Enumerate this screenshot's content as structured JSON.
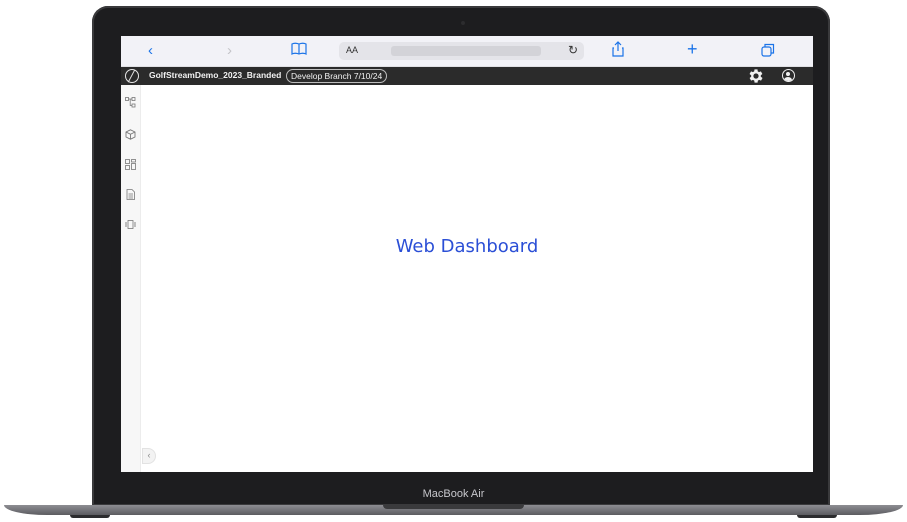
{
  "device": {
    "label": "MacBook Air"
  },
  "browser": {
    "address_prefix": "AA",
    "buttons": [
      "back",
      "forward",
      "bookmarks",
      "reload",
      "share",
      "new-tab",
      "tabs"
    ]
  },
  "app": {
    "project_name": "GolfStreamDemo_2023_Branded",
    "branch_label": "Develop Branch 7/10/24"
  },
  "main": {
    "headline": "Web Dashboard"
  },
  "colors": {
    "accent": "#1a73e8",
    "headline": "#2b4fd6",
    "header_bg": "#2b2b2b"
  }
}
